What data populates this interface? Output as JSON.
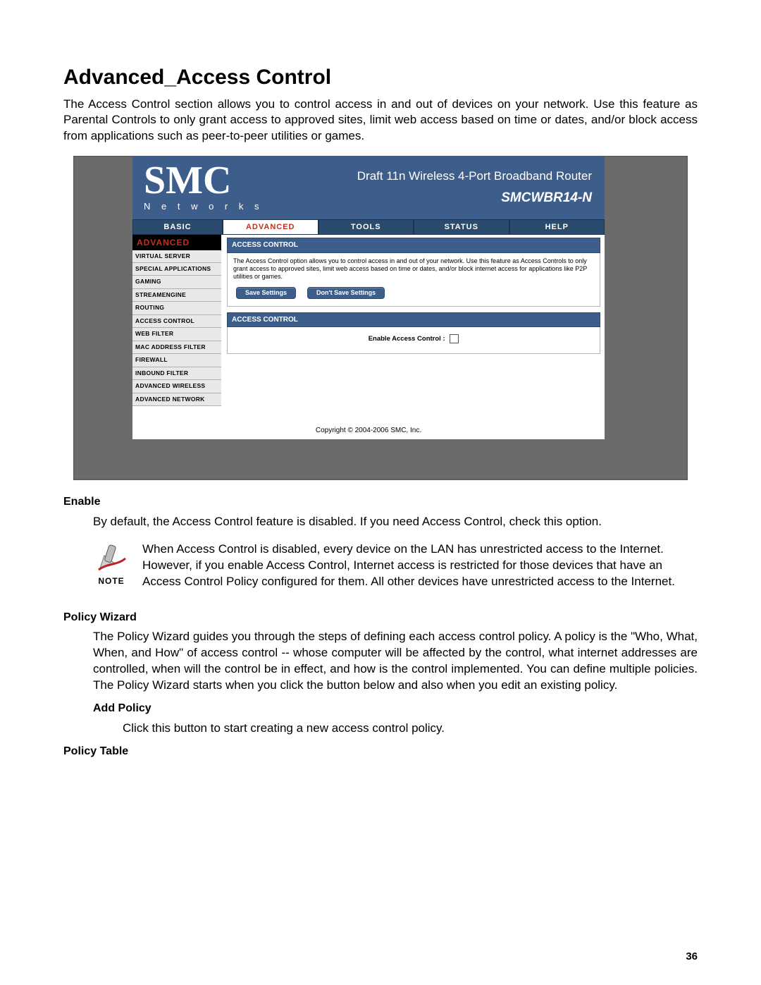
{
  "page_number": "36",
  "title": "Advanced_Access Control",
  "intro": "The Access Control section allows you to control access in and out of devices on your network. Use this feature as Parental Controls to only grant access to approved sites, limit web access based on time or dates, and/or block access from applications such as peer-to-peer utilities or games.",
  "router": {
    "logo_main": "SMC",
    "logo_tag": "N e t w o r k s",
    "header_line1": "Draft 11n Wireless 4-Port Broadband Router",
    "header_line2": "SMCWBR14-N",
    "tabs": [
      "BASIC",
      "ADVANCED",
      "TOOLS",
      "STATUS",
      "HELP"
    ],
    "active_tab_index": 1,
    "sidebar_header": "ADVANCED",
    "sidebar_items": [
      "VIRTUAL SERVER",
      "SPECIAL APPLICATIONS",
      "GAMING",
      "STREAMENGINE",
      "ROUTING",
      "ACCESS CONTROL",
      "WEB FILTER",
      "MAC ADDRESS FILTER",
      "FIREWALL",
      "INBOUND FILTER",
      "ADVANCED WIRELESS",
      "ADVANCED NETWORK"
    ],
    "panel1_title": "ACCESS CONTROL",
    "panel1_text": "The Access Control option allows you to control access in and out of your network. Use this feature as Access Controls to only grant access to approved sites, limit web access based on time or dates, and/or block internet access for applications like P2P utilities or games.",
    "save_btn": "Save Settings",
    "dont_save_btn": "Don't Save Settings",
    "panel2_title": "ACCESS CONTROL",
    "enable_label": "Enable Access Control :",
    "copyright": "Copyright © 2004-2006 SMC, Inc."
  },
  "doc": {
    "enable_term": "Enable",
    "enable_body": "By default, the Access Control feature is disabled. If you need Access Control, check this option.",
    "note_label": "NOTE",
    "note_body": "When Access Control is disabled, every device on the LAN has unrestricted access to the Internet. However, if you enable Access Control, Internet access is restricted for those devices that have an Access Control Policy configured for them. All other devices have unrestricted access to the Internet.",
    "policy_wizard_term": "Policy Wizard",
    "policy_wizard_body": "The Policy Wizard guides you through the steps of defining each access control policy. A policy is the \"Who, What, When, and How\" of access control -- whose computer will be affected by the control, what internet addresses are controlled, when will the control be in effect, and how is the control implemented. You can define multiple policies. The Policy Wizard starts when you click the button below and also when you edit an existing policy.",
    "add_policy_term": "Add Policy",
    "add_policy_body": "Click this button to start creating a new access control policy.",
    "policy_table_term": "Policy Table"
  }
}
